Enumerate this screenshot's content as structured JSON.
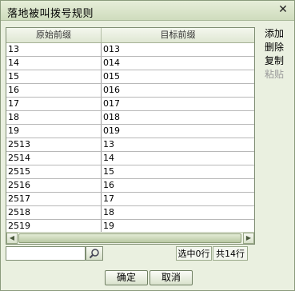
{
  "window": {
    "title": "落地被叫拨号规则"
  },
  "table": {
    "columns": [
      "原始前缀",
      "目标前缀"
    ],
    "rows": [
      [
        "13",
        "013"
      ],
      [
        "14",
        "014"
      ],
      [
        "15",
        "015"
      ],
      [
        "16",
        "016"
      ],
      [
        "17",
        "017"
      ],
      [
        "18",
        "018"
      ],
      [
        "19",
        "019"
      ],
      [
        "2513",
        "13"
      ],
      [
        "2514",
        "14"
      ],
      [
        "2515",
        "15"
      ],
      [
        "2516",
        "16"
      ],
      [
        "2517",
        "17"
      ],
      [
        "2518",
        "18"
      ],
      [
        "2519",
        "19"
      ]
    ]
  },
  "side_actions": [
    {
      "label": "添加",
      "enabled": true
    },
    {
      "label": "删除",
      "enabled": true
    },
    {
      "label": "复制",
      "enabled": true
    },
    {
      "label": "粘贴",
      "enabled": false
    }
  ],
  "search": {
    "value": "",
    "icon": "search-icon"
  },
  "status": {
    "selected": "选中0行",
    "total": "共14行"
  },
  "buttons": {
    "ok": "确定",
    "cancel": "取消"
  }
}
